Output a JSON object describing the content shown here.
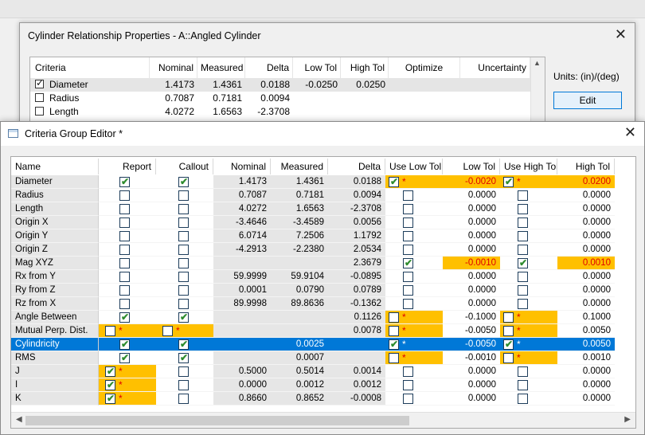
{
  "bg": {
    "title": ""
  },
  "dialog1": {
    "title": "Cylinder Relationship Properties - A::Angled Cylinder",
    "close": "✕",
    "units": "Units: (in)/(deg)",
    "edit": "Edit",
    "columns": [
      "Criteria",
      "Nominal",
      "Measured",
      "Delta",
      "Low Tol",
      "High Tol",
      "Optimize",
      "Uncertainty"
    ],
    "rows": [
      {
        "name": "Diameter",
        "checked": true,
        "nominal": "1.4173",
        "measured": "1.4361",
        "delta": "0.0188",
        "lowtol": "-0.0250",
        "hightol": "0.0250"
      },
      {
        "name": "Radius",
        "checked": false,
        "nominal": "0.7087",
        "measured": "0.7181",
        "delta": "0.0094",
        "lowtol": "",
        "hightol": ""
      },
      {
        "name": "Length",
        "checked": false,
        "nominal": "4.0272",
        "measured": "1.6563",
        "delta": "-2.3708",
        "lowtol": "",
        "hightol": ""
      }
    ]
  },
  "dialog2": {
    "title": "Criteria Group Editor *",
    "close": "✕",
    "columns": [
      "Name",
      "Report",
      "Callout",
      "Nominal",
      "Measured",
      "Delta",
      "Use Low Tol",
      "Low Tol",
      "Use High Tol",
      "High Tol"
    ],
    "check_color": "#2f8c2f",
    "highlight_color": "#ffc000",
    "selected_color": "#0078d7",
    "rows": [
      {
        "name": "Diameter",
        "report": true,
        "callout": true,
        "nominal": "1.4173",
        "measured": "1.4361",
        "delta": "0.0188",
        "uselow": true,
        "low": "-0.0020",
        "usehigh": true,
        "high": "0.0200",
        "state": "lowhigh"
      },
      {
        "name": "Radius",
        "report": false,
        "callout": false,
        "nominal": "0.7087",
        "measured": "0.7181",
        "delta": "0.0094",
        "uselow": false,
        "low": "0.0000",
        "usehigh": false,
        "high": "0.0000"
      },
      {
        "name": "Length",
        "report": false,
        "callout": false,
        "nominal": "4.0272",
        "measured": "1.6563",
        "delta": "-2.3708",
        "uselow": false,
        "low": "0.0000",
        "usehigh": false,
        "high": "0.0000"
      },
      {
        "name": "Origin X",
        "report": false,
        "callout": false,
        "nominal": "-3.4646",
        "measured": "-3.4589",
        "delta": "0.0056",
        "uselow": false,
        "low": "0.0000",
        "usehigh": false,
        "high": "0.0000"
      },
      {
        "name": "Origin Y",
        "report": false,
        "callout": false,
        "nominal": "6.0714",
        "measured": "7.2506",
        "delta": "1.1792",
        "uselow": false,
        "low": "0.0000",
        "usehigh": false,
        "high": "0.0000"
      },
      {
        "name": "Origin Z",
        "report": false,
        "callout": false,
        "nominal": "-4.2913",
        "measured": "-2.2380",
        "delta": "2.0534",
        "uselow": false,
        "low": "0.0000",
        "usehigh": false,
        "high": "0.0000"
      },
      {
        "name": "Mag XYZ",
        "report": false,
        "callout": false,
        "nominal": "",
        "measured": "",
        "delta": "2.3679",
        "uselow": true,
        "low": "-0.0010",
        "usehigh": true,
        "high": "0.0010",
        "state": "magxyz"
      },
      {
        "name": "Rx from Y",
        "report": false,
        "callout": false,
        "nominal": "59.9999",
        "measured": "59.9104",
        "delta": "-0.0895",
        "uselow": false,
        "low": "0.0000",
        "usehigh": false,
        "high": "0.0000"
      },
      {
        "name": "Ry from Z",
        "report": false,
        "callout": false,
        "nominal": "0.0001",
        "measured": "0.0790",
        "delta": "0.0789",
        "uselow": false,
        "low": "0.0000",
        "usehigh": false,
        "high": "0.0000"
      },
      {
        "name": "Rz from X",
        "report": false,
        "callout": false,
        "nominal": "89.9998",
        "measured": "89.8636",
        "delta": "-0.1362",
        "uselow": false,
        "low": "0.0000",
        "usehigh": false,
        "high": "0.0000"
      },
      {
        "name": "Angle Between",
        "report": true,
        "callout": true,
        "nominal": "",
        "measured": "",
        "delta": "0.1126",
        "uselow": false,
        "low": "-0.1000",
        "usehigh": false,
        "high": "0.1000",
        "state": "usestars"
      },
      {
        "name": "Mutual Perp. Dist.",
        "report": false,
        "callout": false,
        "nominal": "",
        "measured": "",
        "delta": "0.0078",
        "uselow": false,
        "low": "-0.0050",
        "usehigh": false,
        "high": "0.0050",
        "state": "mutual"
      },
      {
        "name": "Cylindricity",
        "report": true,
        "callout": true,
        "nominal": "",
        "measured": "0.0025",
        "delta": "",
        "uselow": true,
        "low": "-0.0050",
        "usehigh": true,
        "high": "0.0050",
        "state": "selected"
      },
      {
        "name": "RMS",
        "report": true,
        "callout": true,
        "nominal": "",
        "measured": "0.0007",
        "delta": "",
        "uselow": false,
        "low": "-0.0010",
        "usehigh": false,
        "high": "0.0010",
        "state": "usestars"
      },
      {
        "name": "J",
        "report": true,
        "callout": false,
        "nominal": "0.5000",
        "measured": "0.5014",
        "delta": "0.0014",
        "uselow": false,
        "low": "0.0000",
        "usehigh": false,
        "high": "0.0000",
        "state": "reportstar"
      },
      {
        "name": "I",
        "report": true,
        "callout": false,
        "nominal": "0.0000",
        "measured": "0.0012",
        "delta": "0.0012",
        "uselow": false,
        "low": "0.0000",
        "usehigh": false,
        "high": "0.0000",
        "state": "reportstar"
      },
      {
        "name": "K",
        "report": true,
        "callout": false,
        "nominal": "0.8660",
        "measured": "0.8652",
        "delta": "-0.0008",
        "uselow": false,
        "low": "0.0000",
        "usehigh": false,
        "high": "0.0000",
        "state": "reportstar"
      }
    ]
  }
}
